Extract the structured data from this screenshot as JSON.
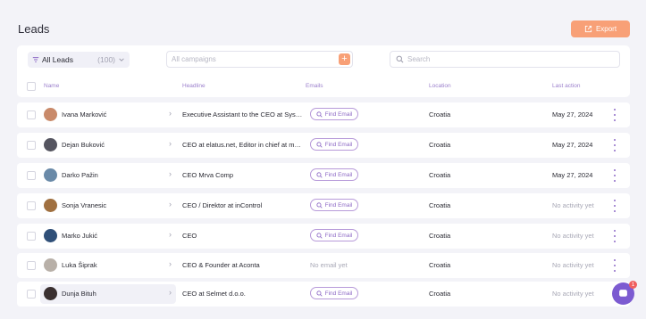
{
  "page": {
    "title": "Leads"
  },
  "toolbar": {
    "export_label": "Export"
  },
  "filters": {
    "leads_select": {
      "label": "All Leads",
      "count": "(100)"
    },
    "campaigns": {
      "placeholder": "All campaigns",
      "add_label": "+"
    },
    "search": {
      "placeholder": "Search"
    }
  },
  "table": {
    "columns": [
      "Name",
      "Headline",
      "Emails",
      "Location",
      "Last action"
    ],
    "rows": [
      {
        "name": "Ivana Marković",
        "headline": "Executive Assistant to the CEO at Sys…",
        "email": "Find Email",
        "location": "Croatia",
        "last_action": "May 27, 2024",
        "avatar_color": "#c98a6a"
      },
      {
        "name": "Dejan Buković",
        "headline": "CEO at elatus.net, Editor in chief at m…",
        "email": "Find Email",
        "location": "Croatia",
        "last_action": "May 27, 2024",
        "avatar_color": "#555560"
      },
      {
        "name": "Darko Pažin",
        "headline": "CEO Mrva Comp",
        "email": "Find Email",
        "location": "Croatia",
        "last_action": "May 27, 2024",
        "avatar_color": "#6a8aa8"
      },
      {
        "name": "Sonja Vranesic",
        "headline": "CEO / Direktor at inControl",
        "email": "Find Email",
        "location": "Croatia",
        "last_action": "No activity yet",
        "avatar_color": "#a07040"
      },
      {
        "name": "Marko Jukić",
        "headline": "CEO",
        "email": "Find Email",
        "location": "Croatia",
        "last_action": "No activity yet",
        "avatar_color": "#2f4f78"
      },
      {
        "name": "Luka Šiprak",
        "headline": "CEO & Founder at Aconta",
        "email": "No email yet",
        "location": "Croatia",
        "last_action": "No activity yet",
        "avatar_color": "#b8b0a8"
      },
      {
        "name": "Dunja Bituh",
        "headline": "CEO at Selmet d.o.o.",
        "email": "Find Email",
        "location": "Croatia",
        "last_action": "No activity yet",
        "avatar_color": "#3a3030"
      }
    ]
  },
  "chat": {
    "badge": "1"
  },
  "colors": {
    "accent_orange": "#f8a077",
    "accent_purple": "#8e6ac6",
    "background": "#f3f3f8"
  }
}
